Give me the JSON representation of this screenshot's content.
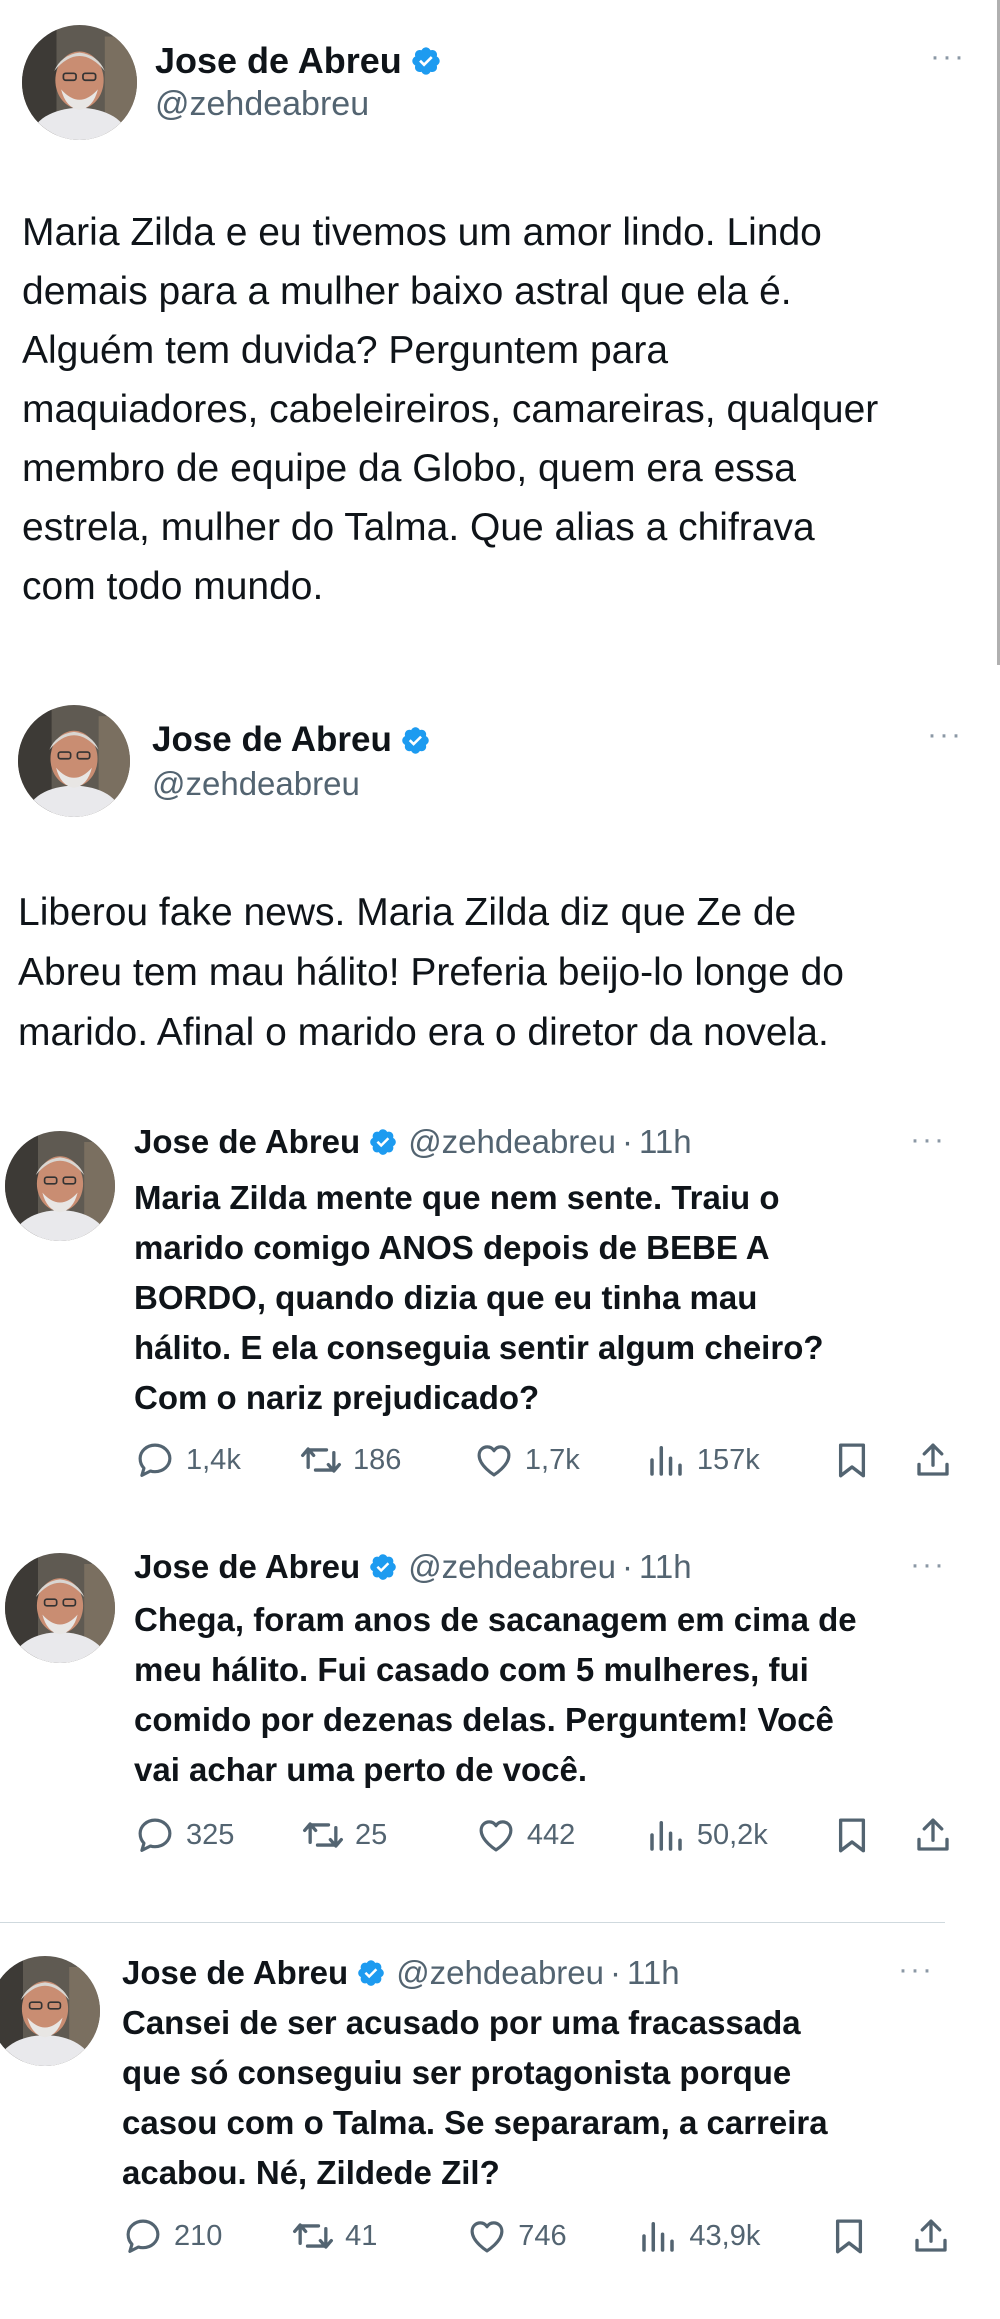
{
  "colors": {
    "verified": "#1d9bf0",
    "text": "#0f1419",
    "muted": "#536471"
  },
  "tweets": [
    {
      "name": "Jose de Abreu",
      "handle": "@zehdeabreu",
      "more": "···",
      "text": "Maria Zilda e eu tivemos um amor lindo. Lindo\ndemais para a mulher baixo astral que ela é.\nAlguém tem duvida? Perguntem para\nmaquiadores, cabeleireiros, camareiras, qualquer\nmembro de equipe da Globo, quem era essa\nestrela, mulher do Talma. Que alias a chifrava\ncom todo mundo."
    },
    {
      "name": "Jose de Abreu",
      "handle": "@zehdeabreu",
      "more": "···",
      "text": "Liberou fake news. Maria Zilda diz que Ze de\nAbreu tem mau hálito! Preferia beijo-lo longe do\nmarido. Afinal o marido era o diretor da novela."
    }
  ],
  "replies": [
    {
      "name": "Jose de Abreu",
      "handle": "@zehdeabreu",
      "time": "11h",
      "more": "···",
      "text": "Maria Zilda mente que nem sente. Traiu o\nmarido comigo ANOS depois de BEBE A\nBORDO, quando dizia que eu tinha mau\nhálito. E ela conseguia sentir algum cheiro?\nCom o nariz prejudicado?",
      "replies_count": "1,4k",
      "retweets": "186",
      "likes": "1,7k",
      "views": "157k"
    },
    {
      "name": "Jose de Abreu",
      "handle": "@zehdeabreu",
      "time": "11h",
      "more": "···",
      "text": "Chega, foram anos de sacanagem em cima de\nmeu hálito. Fui casado com 5 mulheres, fui\ncomido por dezenas delas. Perguntem! Você\nvai achar uma perto de você.",
      "replies_count": "325",
      "retweets": "25",
      "likes": "442",
      "views": "50,2k"
    },
    {
      "name": "Jose de Abreu",
      "handle": "@zehdeabreu",
      "time": "11h",
      "more": "···",
      "text": "Cansei de ser acusado por uma fracassada\nque só conseguiu ser protagonista porque\ncasou com o Talma. Se separaram, a carreira\nacabou. Né, Zildede Zil?",
      "replies_count": "210",
      "retweets": "41",
      "likes": "746",
      "views": "43,9k"
    }
  ]
}
